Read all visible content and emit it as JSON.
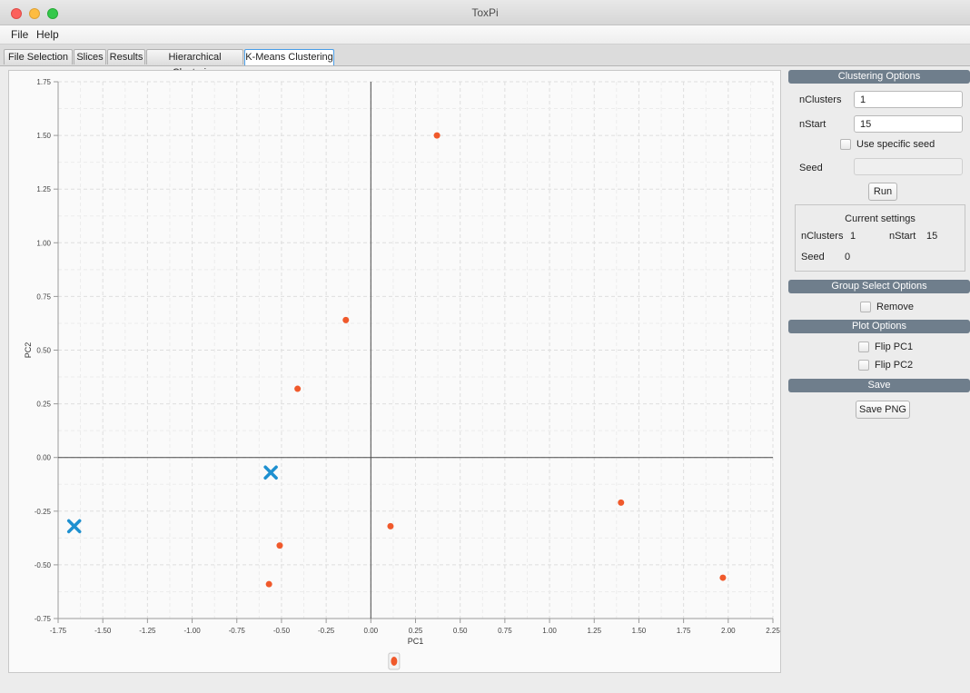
{
  "window": {
    "title": "ToxPi"
  },
  "menu": {
    "file": "File",
    "help": "Help"
  },
  "tabs": [
    {
      "label": "File Selection"
    },
    {
      "label": "Slices"
    },
    {
      "label": "Results"
    },
    {
      "label": "Hierarchical Clustering"
    },
    {
      "label": "K-Means Clustering",
      "active": true
    }
  ],
  "clustering_options": {
    "header": "Clustering Options",
    "nclusters_label": "nClusters",
    "nclusters_value": "1",
    "nstart_label": "nStart",
    "nstart_value": "15",
    "use_seed_label": "Use specific seed",
    "seed_label": "Seed",
    "seed_value": "",
    "run_label": "Run"
  },
  "current_settings": {
    "title": "Current settings",
    "nclusters_label": "nClusters",
    "nclusters_value": "1",
    "nstart_label": "nStart",
    "nstart_value": "15",
    "seed_label": "Seed",
    "seed_value": "0"
  },
  "group_select": {
    "header": "Group Select Options",
    "remove_label": "Remove"
  },
  "plot_options": {
    "header": "Plot Options",
    "flip_pc1_label": "Flip PC1",
    "flip_pc2_label": "Flip PC2"
  },
  "save": {
    "header": "Save",
    "save_png_label": "Save PNG"
  },
  "colors": {
    "accent": "#4a9ee8",
    "point": "#f0592b",
    "centroid": "#1e90d0",
    "section_header": "#6f7e8c"
  },
  "chart_data": {
    "type": "scatter",
    "xlabel": "PC1",
    "ylabel": "PC2",
    "xlim": [
      -1.75,
      2.25
    ],
    "ylim": [
      -0.75,
      1.75
    ],
    "xticks": [
      "-1.75",
      "-1.50",
      "-1.25",
      "-1.00",
      "-0.75",
      "-0.50",
      "-0.25",
      "0.00",
      "0.25",
      "0.50",
      "0.75",
      "1.00",
      "1.25",
      "1.50",
      "1.75",
      "2.00",
      "2.25"
    ],
    "yticks": [
      "1.75",
      "1.50",
      "1.25",
      "1.00",
      "0.75",
      "0.50",
      "0.25",
      "0.00",
      "-0.25",
      "-0.50",
      "-0.75"
    ],
    "grid": true,
    "legend": "bottom",
    "series": [
      {
        "marker": "circle",
        "color": "#f0592b",
        "points": [
          {
            "x": 0.37,
            "y": 1.5
          },
          {
            "x": -0.14,
            "y": 0.64
          },
          {
            "x": -0.41,
            "y": 0.32
          },
          {
            "x": 0.11,
            "y": -0.32
          },
          {
            "x": -0.51,
            "y": -0.41
          },
          {
            "x": -0.57,
            "y": -0.59
          },
          {
            "x": 1.4,
            "y": -0.21
          },
          {
            "x": 1.97,
            "y": -0.56
          }
        ]
      },
      {
        "marker": "x",
        "color": "#1e90d0",
        "points": [
          {
            "x": -0.56,
            "y": -0.07
          },
          {
            "x": -1.66,
            "y": -0.32
          }
        ]
      }
    ]
  }
}
